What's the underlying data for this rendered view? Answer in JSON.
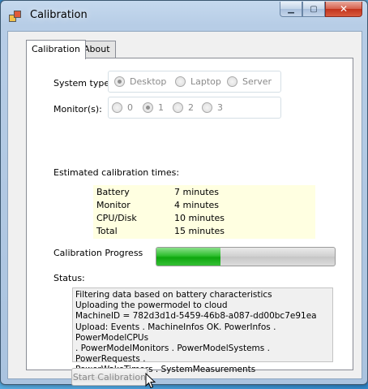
{
  "window": {
    "title": "Calibration"
  },
  "caption_buttons": {
    "minimize": "▁",
    "maximize": "▢",
    "close": "✕"
  },
  "tabs": [
    {
      "label": "Calibration",
      "selected": true
    },
    {
      "label": "About",
      "selected": false
    }
  ],
  "system_type": {
    "label": "System type:",
    "options": [
      "Desktop",
      "Laptop",
      "Server"
    ],
    "selected": "Desktop"
  },
  "monitors": {
    "label": "Monitor(s):",
    "options": [
      "0",
      "1",
      "2",
      "3"
    ],
    "selected": "1"
  },
  "estimates": {
    "heading": "Estimated calibration times:",
    "rows": [
      {
        "name": "Battery",
        "time": "7 minutes"
      },
      {
        "name": "Monitor",
        "time": "4 minutes"
      },
      {
        "name": "CPU/Disk",
        "time": "10 minutes"
      },
      {
        "name": "Total",
        "time": "15 minutes"
      }
    ]
  },
  "progress": {
    "label": "Calibration Progress",
    "value_fraction": 0.36
  },
  "status": {
    "label": "Status:",
    "text": "Filtering data based on battery characteristics\nUploading the powermodel to cloud\nMachineID = 782d3d1d-5459-46b8-a087-dd00bc7e91ea\nUpload: Events . MachineInfos OK. PowerInfos . PowerModelCPUs\n. PowerModelMonitors . PowerModelSystems . PowerRequests .\nPowerWakeTimers . SystemMeasurements"
  },
  "start_button": {
    "label": "Start Calibration",
    "enabled": false
  },
  "colors": {
    "progress_fill": "#1fb51f",
    "estimate_bg": "#ffffe1",
    "close_button": "#c2331c"
  }
}
